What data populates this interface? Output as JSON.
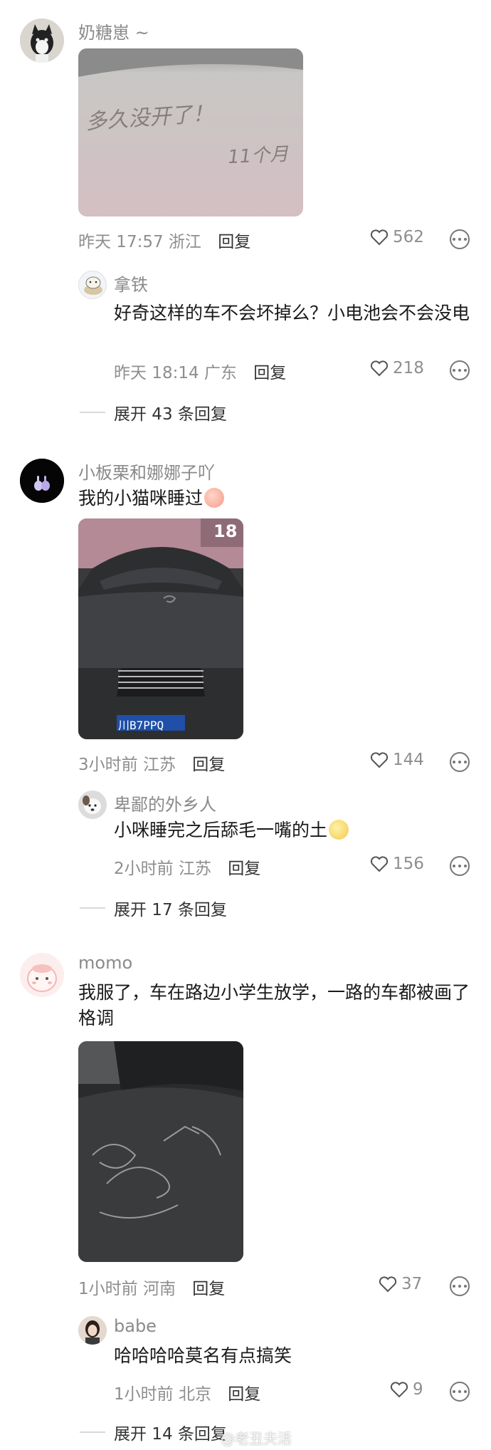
{
  "comments": [
    {
      "username": "奶糖崽 ~",
      "meta_time": "昨天 17:57",
      "meta_location": "浙江",
      "reply_label": "回复",
      "likes": "562",
      "photo_scrawl": [
        "多久没开了！",
        "11个月"
      ],
      "sub": {
        "username": "拿铁",
        "content": "好奇这样的车不会坏掉么？小电池会不会没电",
        "meta_time": "昨天 18:14",
        "meta_location": "广东",
        "reply_label": "回复",
        "likes": "218"
      },
      "expand_label": "展开 43 条回复"
    },
    {
      "username": "小板栗和娜娜子吖",
      "content": "我的小猫咪睡过",
      "meta_time": "3小时前",
      "meta_location": "江苏",
      "reply_label": "回复",
      "likes": "144",
      "photo_plate": "川B7PPQ",
      "photo_sign": "18",
      "sub": {
        "username": "卑鄙的外乡人",
        "content": "小咪睡完之后舔毛一嘴的土",
        "meta_time": "2小时前",
        "meta_location": "江苏",
        "reply_label": "回复",
        "likes": "156"
      },
      "expand_label": "展开 17 条回复"
    },
    {
      "username": "momo",
      "content": "我服了，车在路边小学生放学，一路的车都被画了格调",
      "meta_time": "1小时前",
      "meta_location": "河南",
      "reply_label": "回复",
      "likes": "37",
      "sub": {
        "username": "babe",
        "content": "哈哈哈哈莫名有点搞笑",
        "meta_time": "1小时前",
        "meta_location": "北京",
        "reply_label": "回复",
        "likes": "9"
      },
      "expand_label": "展开 14 条回复"
    }
  ],
  "watermark": "@老丑夫活",
  "icons": {
    "like": "heart-outline-icon",
    "more": "more-options-icon"
  }
}
